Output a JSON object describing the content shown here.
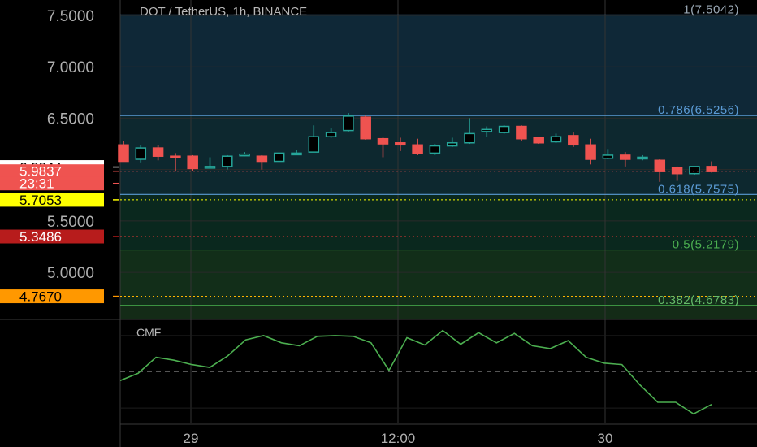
{
  "header": {
    "title": "DOT / TetherUS, 1h, BINANCE"
  },
  "colors": {
    "up": "#26a69a",
    "down": "#ef5350",
    "cmf_line": "#4caf50",
    "fib_top": "#5b9bd5",
    "fib_mid": "#2e7d32",
    "grid": "#2a2a2a",
    "axis_text": "#b0b0b0"
  },
  "price_axis": {
    "ticks": [
      "7.5000",
      "7.0000",
      "6.5000",
      "5.5000",
      "5.0000"
    ],
    "tick_values": [
      7.5,
      7.0,
      6.5,
      5.5,
      5.0
    ]
  },
  "price_labels": [
    {
      "text": "6.0244",
      "value": 6.0244,
      "bg": "#ffffff",
      "fg": "#000000"
    },
    {
      "text": "5.9837",
      "value": 5.9837,
      "bg": "#ef5350",
      "fg": "#ffffff"
    },
    {
      "text": "23:31",
      "value": 5.865,
      "bg": "#ef5350",
      "fg": "#ffffff"
    },
    {
      "text": "5.7053",
      "value": 5.7053,
      "bg": "#ffff00",
      "fg": "#000000"
    },
    {
      "text": "5.3486",
      "value": 5.3486,
      "bg": "#b71c1c",
      "fg": "#ffffff"
    },
    {
      "text": "4.7670",
      "value": 4.767,
      "bg": "#ff9800",
      "fg": "#000000"
    }
  ],
  "fib_levels": [
    {
      "label": "1(7.5042)",
      "ratio": 1,
      "value": 7.5042
    },
    {
      "label": "0.786(6.5256)",
      "ratio": 0.786,
      "value": 6.5256
    },
    {
      "label": "0.618(5.7575)",
      "ratio": 0.618,
      "value": 5.7575
    },
    {
      "label": "0.5(5.2179)",
      "ratio": 0.5,
      "value": 5.2179
    },
    {
      "label": "0.382(4.6783)",
      "ratio": 0.382,
      "value": 4.6783
    }
  ],
  "time_axis": {
    "labels": [
      "29",
      "12:00",
      "30"
    ]
  },
  "indicator": {
    "name": "CMF"
  },
  "chart_data": {
    "type": "candlestick",
    "title": "DOT / TetherUS, 1h, BINANCE",
    "ylim": [
      4.55,
      7.65
    ],
    "candles": [
      {
        "o": 6.24,
        "h": 6.28,
        "l": 6.08,
        "c": 6.08
      },
      {
        "o": 6.1,
        "h": 6.24,
        "l": 6.07,
        "c": 6.21
      },
      {
        "o": 6.21,
        "h": 6.24,
        "l": 6.09,
        "c": 6.13
      },
      {
        "o": 6.13,
        "h": 6.16,
        "l": 5.98,
        "c": 6.12
      },
      {
        "o": 6.13,
        "h": 6.14,
        "l": 5.99,
        "c": 6.01
      },
      {
        "o": 6.02,
        "h": 6.12,
        "l": 6.01,
        "c": 6.03
      },
      {
        "o": 6.03,
        "h": 6.14,
        "l": 6.0,
        "c": 6.13
      },
      {
        "o": 6.15,
        "h": 6.17,
        "l": 6.13,
        "c": 6.15
      },
      {
        "o": 6.13,
        "h": 6.14,
        "l": 6.0,
        "c": 6.08
      },
      {
        "o": 6.08,
        "h": 6.16,
        "l": 6.08,
        "c": 6.16
      },
      {
        "o": 6.16,
        "h": 6.19,
        "l": 6.15,
        "c": 6.16
      },
      {
        "o": 6.17,
        "h": 6.43,
        "l": 6.17,
        "c": 6.32
      },
      {
        "o": 6.32,
        "h": 6.4,
        "l": 6.31,
        "c": 6.36
      },
      {
        "o": 6.38,
        "h": 6.55,
        "l": 6.37,
        "c": 6.52
      },
      {
        "o": 6.51,
        "h": 6.53,
        "l": 6.29,
        "c": 6.3
      },
      {
        "o": 6.3,
        "h": 6.31,
        "l": 6.12,
        "c": 6.25
      },
      {
        "o": 6.26,
        "h": 6.31,
        "l": 6.18,
        "c": 6.24
      },
      {
        "o": 6.24,
        "h": 6.3,
        "l": 6.14,
        "c": 6.16
      },
      {
        "o": 6.16,
        "h": 6.25,
        "l": 6.14,
        "c": 6.23
      },
      {
        "o": 6.23,
        "h": 6.31,
        "l": 6.22,
        "c": 6.26
      },
      {
        "o": 6.26,
        "h": 6.5,
        "l": 6.25,
        "c": 6.35
      },
      {
        "o": 6.37,
        "h": 6.42,
        "l": 6.32,
        "c": 6.39
      },
      {
        "o": 6.36,
        "h": 6.43,
        "l": 6.35,
        "c": 6.42
      },
      {
        "o": 6.42,
        "h": 6.43,
        "l": 6.28,
        "c": 6.3
      },
      {
        "o": 6.31,
        "h": 6.32,
        "l": 6.25,
        "c": 6.26
      },
      {
        "o": 6.27,
        "h": 6.35,
        "l": 6.26,
        "c": 6.32
      },
      {
        "o": 6.33,
        "h": 6.36,
        "l": 6.22,
        "c": 6.24
      },
      {
        "o": 6.24,
        "h": 6.3,
        "l": 6.05,
        "c": 6.1
      },
      {
        "o": 6.11,
        "h": 6.2,
        "l": 6.1,
        "c": 6.14
      },
      {
        "o": 6.14,
        "h": 6.17,
        "l": 6.03,
        "c": 6.1
      },
      {
        "o": 6.12,
        "h": 6.14,
        "l": 6.09,
        "c": 6.12
      },
      {
        "o": 6.09,
        "h": 6.1,
        "l": 5.88,
        "c": 5.98
      },
      {
        "o": 6.02,
        "h": 6.03,
        "l": 5.89,
        "c": 5.96
      },
      {
        "o": 5.96,
        "h": 6.03,
        "l": 5.95,
        "c": 6.03
      },
      {
        "o": 6.03,
        "h": 6.08,
        "l": 5.97,
        "c": 5.98
      }
    ],
    "cmf": [
      -0.12,
      -0.02,
      0.2,
      0.16,
      0.1,
      0.06,
      0.22,
      0.44,
      0.5,
      0.4,
      0.36,
      0.49,
      0.5,
      0.49,
      0.4,
      0.02,
      0.47,
      0.37,
      0.57,
      0.38,
      0.54,
      0.4,
      0.53,
      0.36,
      0.32,
      0.43,
      0.2,
      0.12,
      0.1,
      -0.18,
      -0.42,
      -0.42,
      -0.58,
      -0.45
    ],
    "cmf_ylim": [
      -0.7,
      0.7
    ]
  }
}
